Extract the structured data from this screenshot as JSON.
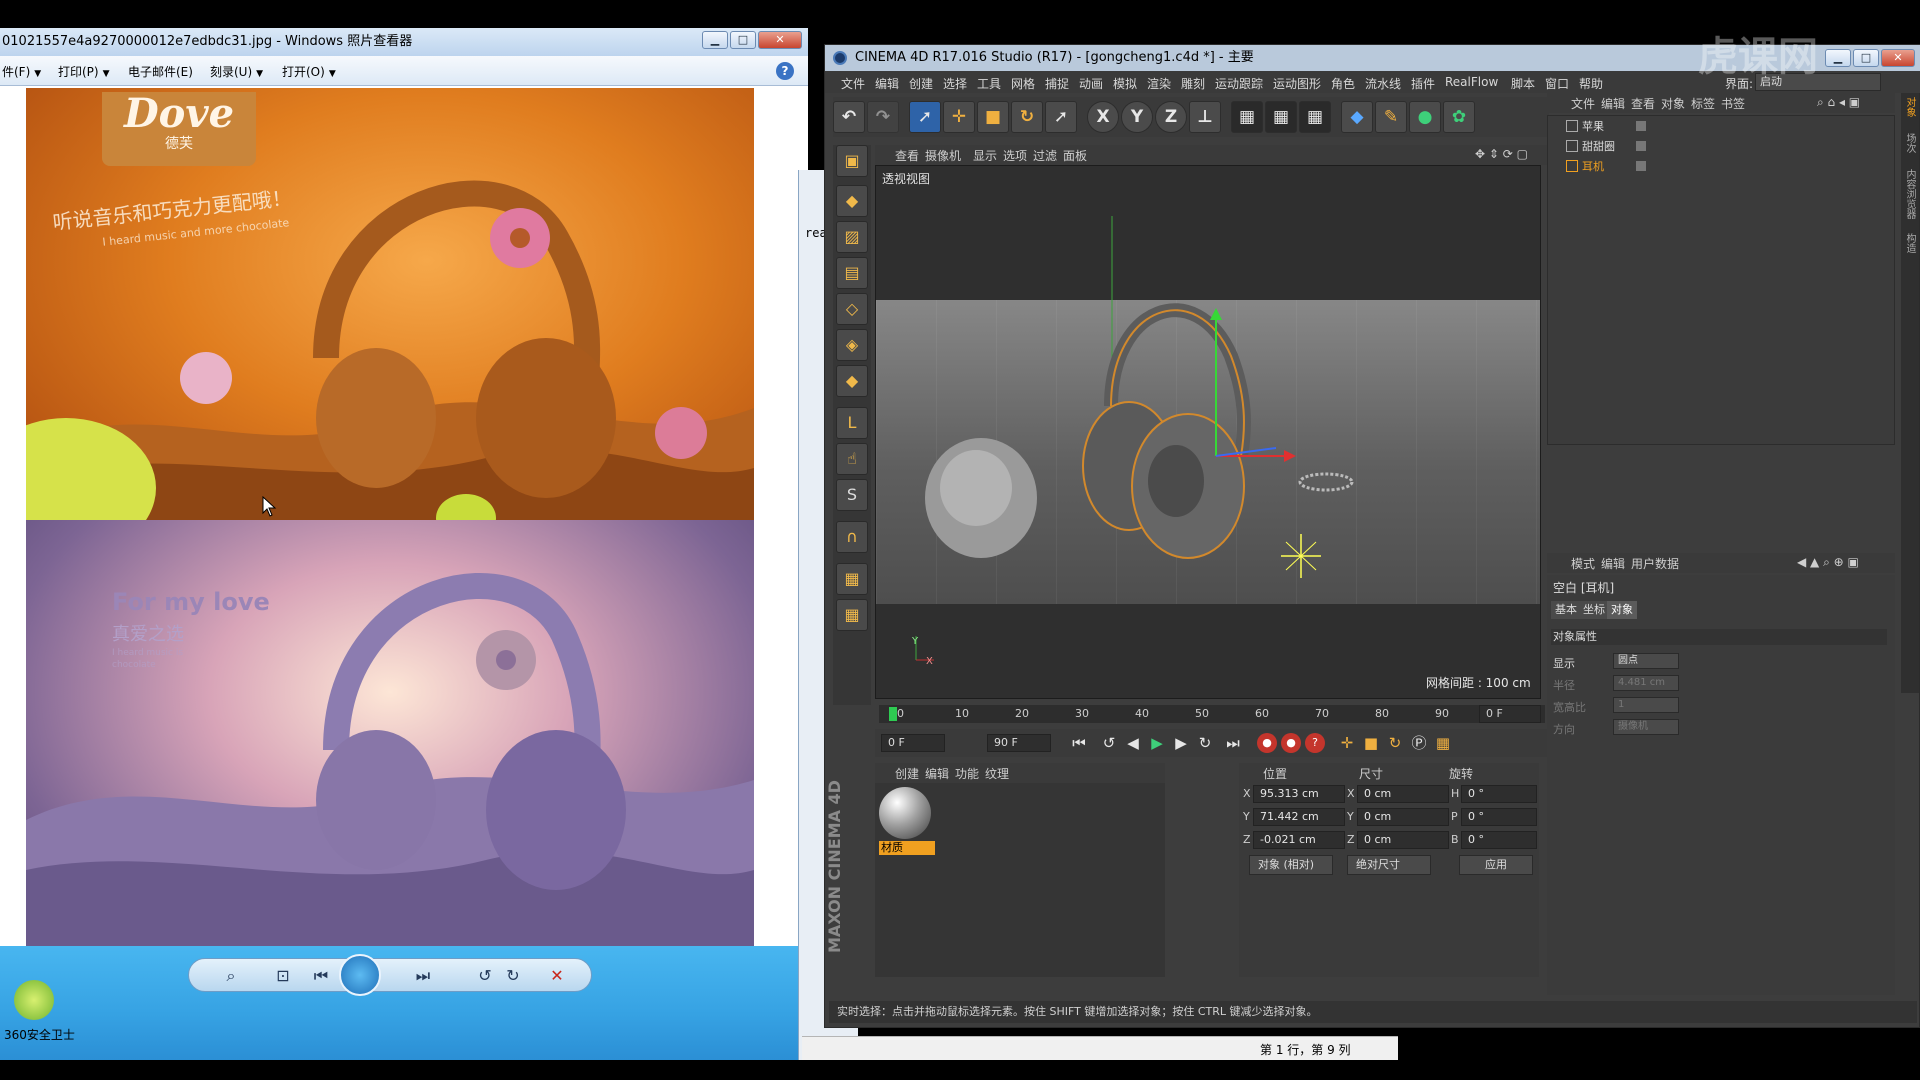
{
  "photo_viewer": {
    "title": "01021557e4a9270000012e7edbdc31.jpg - Windows 照片查看器",
    "menu": [
      "件(F)",
      "打印(P)",
      "电子邮件(E)",
      "刻录(U)",
      "打开(O)"
    ],
    "poster_top": {
      "brand_en": "Dove",
      "brand_cn": "德芙",
      "slogan_cn": "听说音乐和巧克力更配哦！",
      "slogan_en": "I heard music and more chocolate"
    },
    "poster_bottom": {
      "title": "For my love",
      "subtitle": "真爱之选",
      "line1": "I heard music is",
      "line2": "chocolate"
    },
    "security_label": "360安全卫士"
  },
  "behind_window": {
    "text": "rea"
  },
  "taskbar_status": {
    "row_col": "第 1 行，第 9 列"
  },
  "c4d": {
    "title": "CINEMA 4D R17.016 Studio (R17) - [gongcheng1.c4d *] - 主要",
    "menu": [
      "文件",
      "编辑",
      "创建",
      "选择",
      "工具",
      "网格",
      "捕捉",
      "动画",
      "模拟",
      "渲染",
      "雕刻",
      "运动跟踪",
      "运动图形",
      "角色",
      "流水线",
      "插件",
      "RealFlow",
      "脚本",
      "窗口",
      "帮助"
    ],
    "layout_label": "界面:",
    "layout_value": "启动",
    "toolbar_letters": [
      "X",
      "Y",
      "Z"
    ],
    "viewport_menu": [
      "查看",
      "摄像机",
      "显示",
      "选项",
      "过滤",
      "面板"
    ],
    "viewport_label": "透视视图",
    "grid_info": "网格间距 : 100 cm",
    "timeline_ticks": [
      "0",
      "10",
      "20",
      "30",
      "40",
      "50",
      "60",
      "70",
      "80",
      "90"
    ],
    "timeline_end": "0 F",
    "transport": {
      "start": "0 F",
      "end": "90 F"
    },
    "material_menu": [
      "创建",
      "编辑",
      "功能",
      "纹理"
    ],
    "material_name": "材质",
    "brand_vertical": "MAXON CINEMA 4D",
    "coord_headers": [
      "位置",
      "尺寸",
      "旋转"
    ],
    "coords": {
      "px": "95.313 cm",
      "py": "71.442 cm",
      "pz": "-0.021 cm",
      "sx": "0 cm",
      "sy": "0 cm",
      "sz": "0 cm",
      "rh": "0 °",
      "rp": "0 °",
      "rb": "0 °"
    },
    "coord_mode": "对象 (相对)",
    "coord_size_mode": "绝对尺寸",
    "apply": "应用",
    "status": "实时选择：点击并拖动鼠标选择元素。按住 SHIFT 键增加选择对象；按住 CTRL 键减少选择对象。",
    "object_menu": [
      "文件",
      "编辑",
      "查看",
      "对象",
      "标签",
      "书签"
    ],
    "objects": [
      "苹果",
      "甜甜圈",
      "耳机"
    ],
    "attr_menu": [
      "模式",
      "编辑",
      "用户数据"
    ],
    "attr_object": "空白 [耳机]",
    "attr_tabs": [
      "基本",
      "坐标",
      "对象"
    ],
    "attr_section": "对象属性",
    "attr_rows": [
      {
        "label": "显示",
        "value": "圆点"
      },
      {
        "label": "半径",
        "value": "4.481 cm"
      },
      {
        "label": "宽高比",
        "value": "1"
      },
      {
        "label": "方向",
        "value": "摄像机"
      }
    ],
    "right_tabs": [
      "对象",
      "场次",
      "内容浏览器",
      "构造"
    ]
  },
  "watermark": "虎课网"
}
